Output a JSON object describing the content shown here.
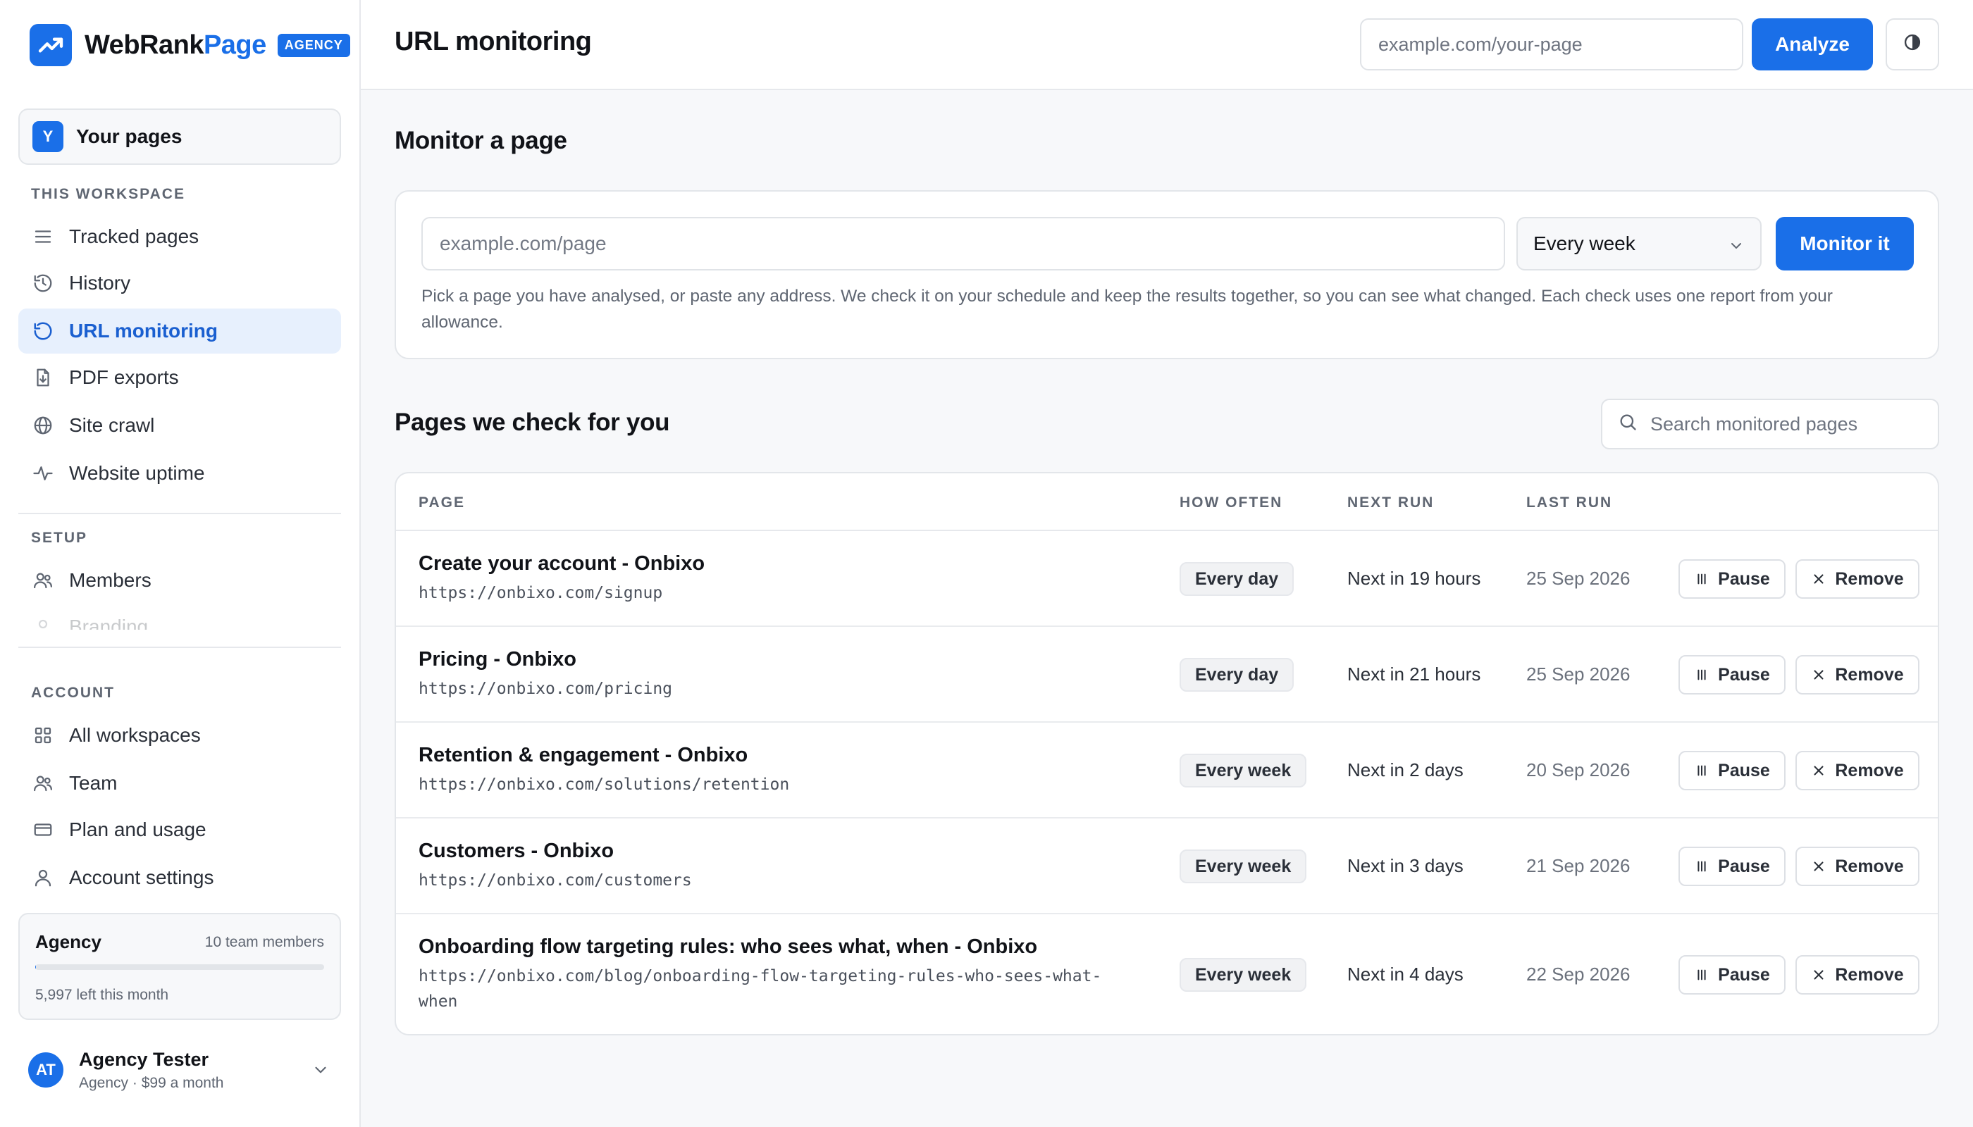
{
  "brand": {
    "name_main": "WebRank",
    "name_accent": "Page",
    "badge": "AGENCY"
  },
  "workspace": {
    "avatar": "Y",
    "name": "Your pages"
  },
  "sidebar": {
    "this_workspace_title": "THIS WORKSPACE",
    "this_workspace": [
      {
        "label": "Tracked pages",
        "icon": "list-icon"
      },
      {
        "label": "History",
        "icon": "history-icon"
      },
      {
        "label": "URL monitoring",
        "icon": "refresh-icon",
        "active": true
      },
      {
        "label": "PDF exports",
        "icon": "file-export-icon"
      },
      {
        "label": "Site crawl",
        "icon": "globe-icon"
      },
      {
        "label": "Website uptime",
        "icon": "pulse-icon"
      }
    ],
    "setup_title": "SETUP",
    "setup": [
      {
        "label": "Members",
        "icon": "users-icon"
      },
      {
        "label": "Branding",
        "icon": "brush-icon"
      }
    ],
    "account_title": "ACCOUNT",
    "account": [
      {
        "label": "All workspaces",
        "icon": "grid-icon"
      },
      {
        "label": "Team",
        "icon": "users-icon"
      },
      {
        "label": "Plan and usage",
        "icon": "card-icon"
      },
      {
        "label": "Account settings",
        "icon": "user-icon"
      }
    ]
  },
  "plan": {
    "name": "Agency",
    "members": "10 team members",
    "left": "5,997 left this month",
    "used_fraction": 0.0005
  },
  "user": {
    "initials": "AT",
    "name": "Agency Tester",
    "plan": "Agency · $99 a month"
  },
  "topbar": {
    "title": "URL monitoring",
    "url_placeholder": "example.com/your-page",
    "analyze_label": "Analyze"
  },
  "monitor": {
    "title": "Monitor a page",
    "input_placeholder": "example.com/page",
    "frequency": "Every week",
    "button_label": "Monitor it",
    "help": "Pick a page you have analysed, or paste any address. We check it on your schedule and keep the results together, so you can see what changed. Each check uses one report from your allowance."
  },
  "pages": {
    "title": "Pages we check for you",
    "search_placeholder": "Search monitored pages",
    "columns": {
      "page": "PAGE",
      "how_often": "HOW OFTEN",
      "next_run": "NEXT RUN",
      "last_run": "LAST RUN"
    },
    "pause_label": "Pause",
    "remove_label": "Remove",
    "rows": [
      {
        "title": "Create your account - Onbixo",
        "url": "https://onbixo.com/signup",
        "how_often": "Every day",
        "next_run": "Next in 19 hours",
        "last_run": "25 Sep 2026"
      },
      {
        "title": "Pricing - Onbixo",
        "url": "https://onbixo.com/pricing",
        "how_often": "Every day",
        "next_run": "Next in 21 hours",
        "last_run": "25 Sep 2026"
      },
      {
        "title": "Retention & engagement - Onbixo",
        "url": "https://onbixo.com/solutions/retention",
        "how_often": "Every week",
        "next_run": "Next in 2 days",
        "last_run": "20 Sep 2026"
      },
      {
        "title": "Customers - Onbixo",
        "url": "https://onbixo.com/customers",
        "how_often": "Every week",
        "next_run": "Next in 3 days",
        "last_run": "21 Sep 2026"
      },
      {
        "title": "Onboarding flow targeting rules: who sees what, when - Onbixo",
        "url": "https://onbixo.com/blog/onboarding-flow-targeting-rules-who-sees-what-when",
        "how_often": "Every week",
        "next_run": "Next in 4 days",
        "last_run": "22 Sep 2026"
      }
    ]
  },
  "colors": {
    "accent": "#1a6fe8",
    "active_bg": "#e7f0fd"
  }
}
